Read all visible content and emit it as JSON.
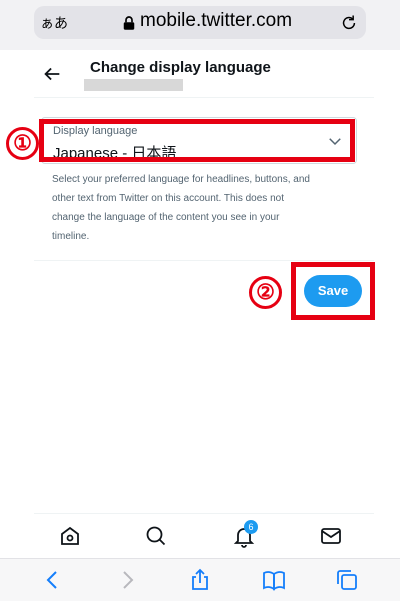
{
  "browser": {
    "text_size_label": "ぁあ",
    "url": "mobile.twitter.com"
  },
  "header": {
    "title": "Change display language"
  },
  "language_field": {
    "label": "Display language",
    "value": "Japanese - 日本語"
  },
  "help_text": "Select your preferred language for headlines, buttons, and other text from Twitter on this account. This does not change the language of the content you see in your timeline.",
  "save_label": "Save",
  "annotations": {
    "step1": "①",
    "step2": "②"
  },
  "tabbar": {
    "items": [
      "home-icon",
      "search-icon",
      "bell-icon",
      "mail-icon"
    ],
    "notification_count": "6"
  },
  "safari_toolbar": {
    "items": [
      "back-icon",
      "forward-icon",
      "share-icon",
      "bookmarks-icon",
      "tabs-icon"
    ]
  },
  "colors": {
    "accent": "#1d9bf0",
    "annotation": "#e60012"
  }
}
